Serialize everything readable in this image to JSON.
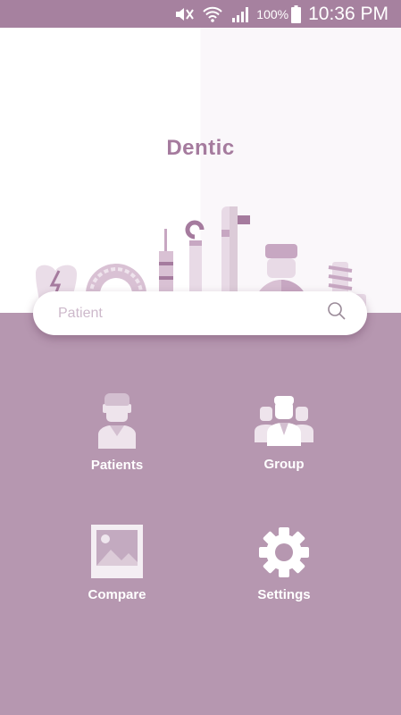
{
  "status_bar": {
    "battery": "100%",
    "time": "10:36 PM",
    "icons": [
      "mute-icon",
      "wifi-icon",
      "signal-icon",
      "battery-icon"
    ]
  },
  "app": {
    "title": "Dentic"
  },
  "search": {
    "placeholder": "Patient",
    "value": ""
  },
  "menu": {
    "patients": {
      "label": "Patients",
      "icon": "patient-avatar-icon"
    },
    "group": {
      "label": "Group",
      "icon": "group-icon"
    },
    "compare": {
      "label": "Compare",
      "icon": "image-icon"
    },
    "settings": {
      "label": "Settings",
      "icon": "gear-icon"
    }
  },
  "colors": {
    "status_bar": "#a6819f",
    "background": "#b697b0",
    "accent": "#a57b9e",
    "illustration_light": "#e8dae6",
    "illustration_dark": "#c7a7c2"
  }
}
